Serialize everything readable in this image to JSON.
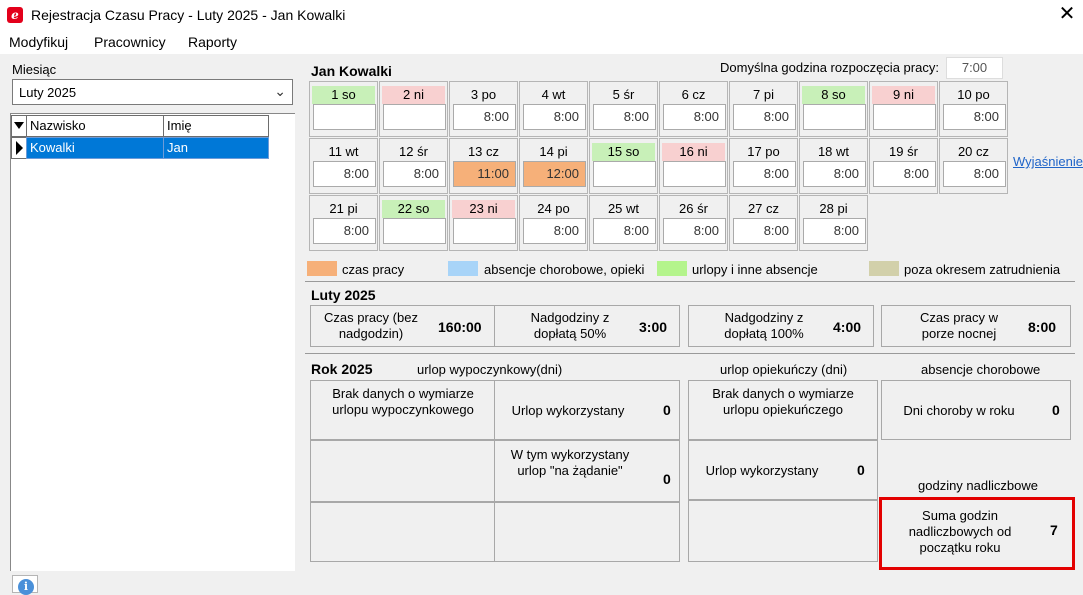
{
  "window": {
    "title": "Rejestracja Czasu Pracy - Luty 2025 - Jan Kowalki",
    "close_glyph": "✕"
  },
  "menu": [
    "Modyfikuj",
    "Pracownicy",
    "Raporty"
  ],
  "left": {
    "month_label": "Miesiąc",
    "month_value": "Luty 2025",
    "columns": [
      "Nazwisko",
      "Imię"
    ],
    "rows": [
      {
        "surname": "Kowalki",
        "name": "Jan"
      }
    ]
  },
  "header": {
    "employee": "Jan Kowalki",
    "start_label": "Domyślna godzina rozpoczęcia pracy:",
    "start_value": "7:00"
  },
  "calendar": [
    {
      "label": "1 so",
      "value": "",
      "type": "green"
    },
    {
      "label": "2 ni",
      "value": "",
      "type": "red"
    },
    {
      "label": "3 po",
      "value": "8:00",
      "type": ""
    },
    {
      "label": "4 wt",
      "value": "8:00",
      "type": ""
    },
    {
      "label": "5 śr",
      "value": "8:00",
      "type": ""
    },
    {
      "label": "6 cz",
      "value": "8:00",
      "type": ""
    },
    {
      "label": "7 pi",
      "value": "8:00",
      "type": ""
    },
    {
      "label": "8 so",
      "value": "",
      "type": "green"
    },
    {
      "label": "9 ni",
      "value": "",
      "type": "red"
    },
    {
      "label": "10 po",
      "value": "8:00",
      "type": ""
    },
    {
      "label": "11 wt",
      "value": "8:00",
      "type": ""
    },
    {
      "label": "12 śr",
      "value": "8:00",
      "type": ""
    },
    {
      "label": "13 cz",
      "value": "11:00",
      "type": "orange"
    },
    {
      "label": "14 pi",
      "value": "12:00",
      "type": "orange"
    },
    {
      "label": "15 so",
      "value": "",
      "type": "green"
    },
    {
      "label": "16 ni",
      "value": "",
      "type": "red"
    },
    {
      "label": "17 po",
      "value": "8:00",
      "type": ""
    },
    {
      "label": "18 wt",
      "value": "8:00",
      "type": ""
    },
    {
      "label": "19 śr",
      "value": "8:00",
      "type": ""
    },
    {
      "label": "20 cz",
      "value": "8:00",
      "type": ""
    },
    {
      "label": "21 pi",
      "value": "8:00",
      "type": ""
    },
    {
      "label": "22 so",
      "value": "",
      "type": "green"
    },
    {
      "label": "23 ni",
      "value": "",
      "type": "red"
    },
    {
      "label": "24 po",
      "value": "8:00",
      "type": ""
    },
    {
      "label": "25 wt",
      "value": "8:00",
      "type": ""
    },
    {
      "label": "26 śr",
      "value": "8:00",
      "type": ""
    },
    {
      "label": "27 cz",
      "value": "8:00",
      "type": ""
    },
    {
      "label": "28 pi",
      "value": "8:00",
      "type": ""
    }
  ],
  "shortcuts_link": "Wyjaśnienie skrótów",
  "legend": [
    {
      "label": "czas pracy",
      "color": "#f6b079"
    },
    {
      "label": "absencje chorobowe, opieki",
      "color": "#a8d4f8"
    },
    {
      "label": "urlopy i inne absencje",
      "color": "#b4f48c"
    },
    {
      "label": "poza okresem zatrudnienia",
      "color": "#d2d0aa"
    }
  ],
  "month_summary": {
    "title": "Luty 2025",
    "items": [
      {
        "label": "Czas pracy (bez nadgodzin)",
        "value": "160:00"
      },
      {
        "label": "Nadgodziny z dopłatą 50%",
        "value": "3:00"
      },
      {
        "label": "Nadgodziny z dopłatą 100%",
        "value": "4:00"
      },
      {
        "label": "Czas pracy w porze nocnej",
        "value": "8:00"
      }
    ]
  },
  "year": {
    "title": "Rok 2025",
    "col_vacation": "urlop wypoczynkowy(dni)",
    "col_care": "urlop opiekuńczy (dni)",
    "col_sick": "absencje chorobowe",
    "vac_nodata": "Brak danych o wymiarze urlopu wypoczynkowego",
    "vac_used_label": "Urlop wykorzystany",
    "vac_used_value": "0",
    "vac_demand_label": "W tym wykorzystany urlop \"na żądanie\"",
    "vac_demand_value": "0",
    "care_nodata": "Brak danych o wymiarze urlopu opiekuńczego",
    "care_used_label": "Urlop wykorzystany",
    "care_used_value": "0",
    "sick_label": "Dni choroby w roku",
    "sick_value": "0",
    "overtime_header": "godziny nadliczbowe",
    "overtime_label": "Suma godzin nadliczbowych od początku roku",
    "overtime_value": "7"
  }
}
